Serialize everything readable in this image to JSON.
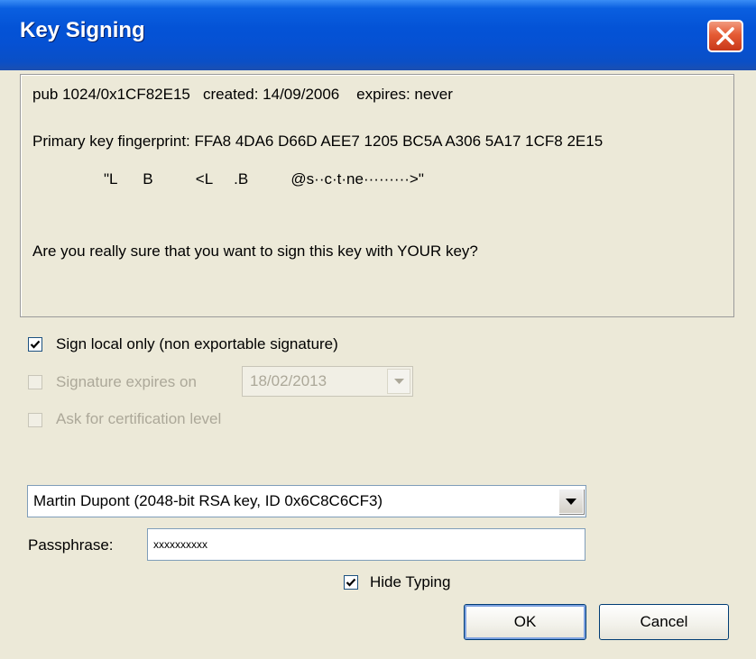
{
  "window": {
    "title": "Key Signing",
    "close_icon": "close-x-icon"
  },
  "key_info": {
    "pub_line": "pub 1024/0x1CF82E15   created: 14/09/2006    expires: never",
    "fingerprint_line": "Primary key fingerprint: FFA8 4DA6 D66D AEE7 1205 BC5A A306 5A17 1CF8 2E15",
    "uid_line": "\"L      B          <L     .B          @s··c·t·ne·········>\"",
    "question": "Are you really sure that you want to sign this key with YOUR key?"
  },
  "options": {
    "sign_local": {
      "label": "Sign local only (non exportable signature)",
      "checked": true,
      "enabled": true
    },
    "sig_expires": {
      "label": "Signature expires on",
      "checked": false,
      "enabled": false,
      "date": "18/02/2013"
    },
    "cert_level": {
      "label": "Ask for certification level",
      "checked": false,
      "enabled": false
    }
  },
  "signing_key": {
    "selected": "Martin Dupont (2048-bit RSA key, ID 0x6C8C6CF3)"
  },
  "passphrase": {
    "label": "Passphrase:",
    "value": "xxxxxxxxxx"
  },
  "hide_typing": {
    "label": "Hide Typing",
    "checked": true
  },
  "buttons": {
    "ok": "OK",
    "cancel": "Cancel"
  },
  "colors": {
    "title_bar": "#0453d6",
    "dialog_bg": "#ece9d8",
    "close_button": "#e55b34"
  }
}
